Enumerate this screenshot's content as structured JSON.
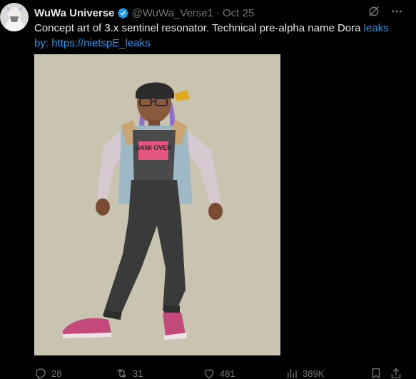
{
  "author": {
    "display_name": "WuWa Universe",
    "handle": "@WuWa_Verse1",
    "separator": "·",
    "date": "Oct 25"
  },
  "text": {
    "main": "Concept art of 3.x sentinel resonator. Technical pre-alpha name Dora ",
    "link_leaks": "leaks",
    "line2_prefix": "by: ",
    "link_handle": "https://nietspE_leaks"
  },
  "media": {
    "alt": "",
    "shirt_text": "GAMI OVER"
  },
  "actions": {
    "replies": "28",
    "reposts": "31",
    "likes": "481",
    "views": "389K"
  },
  "colors": {
    "background": "#000000",
    "text": "#e7e9ea",
    "muted": "#71767b",
    "link": "#1d9bf0",
    "verified": "#1d9bf0"
  },
  "icons": {
    "verified": "verified-badge-icon",
    "grok": "grok-icon",
    "more": "more-icon",
    "reply": "reply-icon",
    "repost": "repost-icon",
    "like": "like-icon",
    "views": "views-icon",
    "bookmark": "bookmark-icon",
    "share": "share-icon"
  }
}
